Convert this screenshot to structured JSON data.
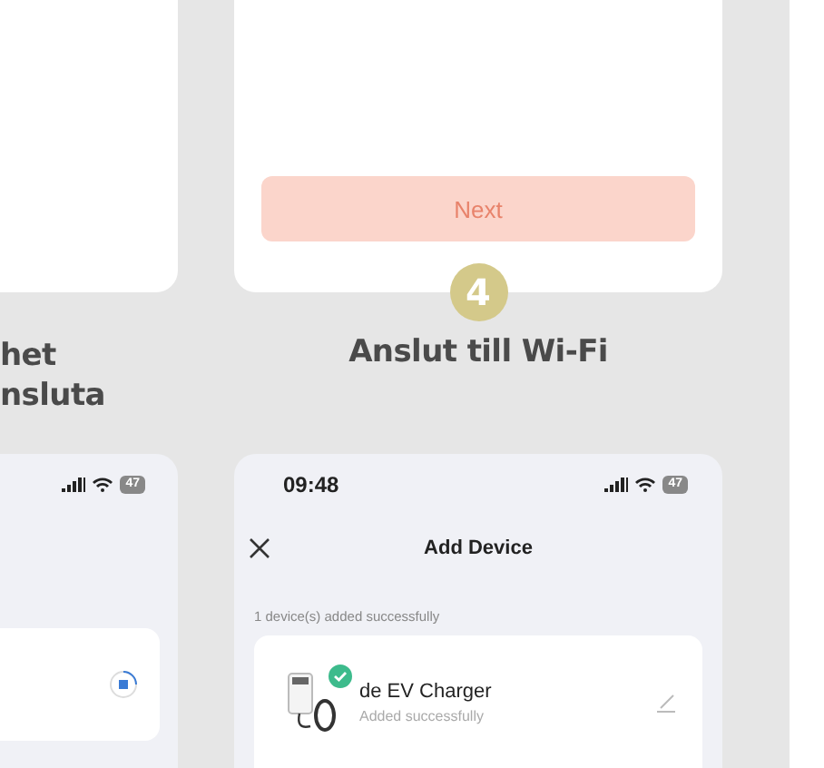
{
  "steps": [
    {
      "caption_lines": [
        "het",
        "nsluta"
      ]
    },
    {
      "next_button": {
        "label": "Next",
        "disabled": true
      },
      "step_number": "4",
      "caption_lines": [
        "Anslut till Wi-Fi"
      ]
    }
  ],
  "left_phone": {
    "battery": "47"
  },
  "right_phone": {
    "time": "09:48",
    "battery": "47",
    "title": "Add Device",
    "summary": "1 device(s) added successfully",
    "devices": [
      {
        "name": "de EV Charger",
        "status": "Added successfully",
        "added": true
      }
    ]
  }
}
